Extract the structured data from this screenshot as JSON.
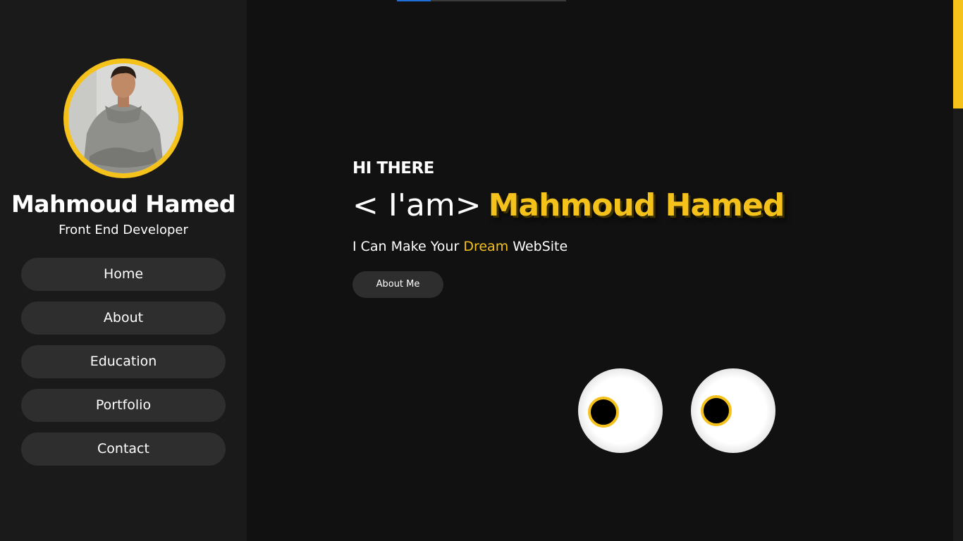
{
  "sidebar": {
    "profile_name": "Mahmoud Hamed",
    "profile_role": "Front End Developer",
    "nav": [
      {
        "label": "Home"
      },
      {
        "label": "About"
      },
      {
        "label": "Education"
      },
      {
        "label": "Portfolio"
      },
      {
        "label": "Contact"
      }
    ]
  },
  "hero": {
    "greeting": "HI THERE",
    "headline_prefix": "< I'am>",
    "headline_name": "Mahmoud Hamed",
    "tagline_start": "I Can Make Your",
    "tagline_highlight": "Dream",
    "tagline_end": "WebSite",
    "about_button": "About Me"
  },
  "colors": {
    "accent": "#f5c21b",
    "background": "#111111",
    "sidebar": "#1a1a1a",
    "button": "#2e2e2e",
    "text": "#ffffff",
    "progress": "#1e6fd9"
  },
  "top_progress_fraction": 0.2,
  "scroll_fraction_visible": 0.2,
  "icons": {
    "avatar": "profile-photo",
    "eyes": "googly-eyes-decoration"
  }
}
